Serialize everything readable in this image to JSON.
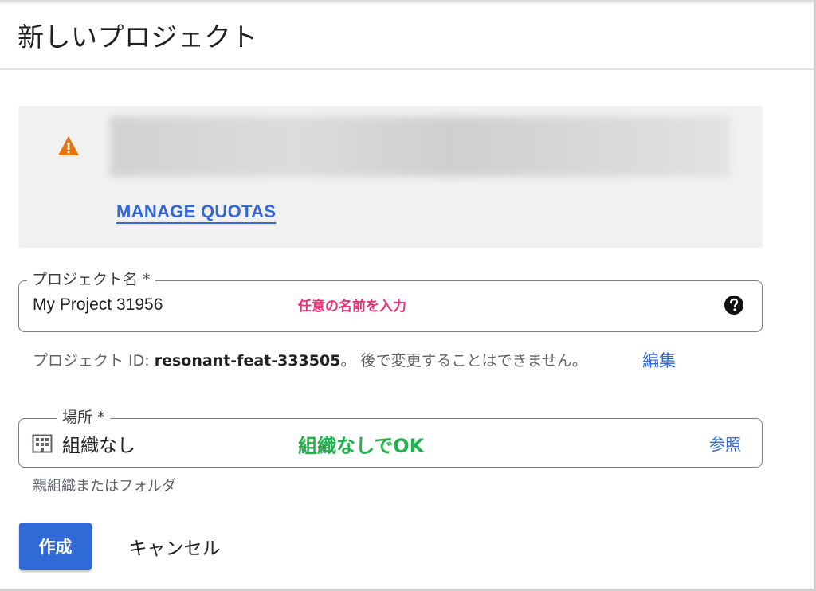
{
  "header": {
    "title": "新しいプロジェクト"
  },
  "alert": {
    "icon": "warning-icon",
    "icon_color": "#e8710a",
    "link_label": "MANAGE QUOTAS"
  },
  "project_name": {
    "label": "プロジェクト名 *",
    "value": "My Project 31956",
    "annotation": "任意の名前を入力",
    "help_icon": "help-circle-icon"
  },
  "project_id": {
    "prefix": "プロジェクト ID: ",
    "id": "resonant-feat-333505",
    "suffix": "。 後で変更することはできません。",
    "edit_label": "編集"
  },
  "location": {
    "label": "場所 *",
    "icon": "building-icon",
    "value": "組織なし",
    "annotation": "組織なしでOK",
    "browse_label": "参照",
    "helper": "親組織またはフォルダ"
  },
  "actions": {
    "create_label": "作成",
    "cancel_label": "キャンセル",
    "accent_color": "#2f6ad6"
  }
}
